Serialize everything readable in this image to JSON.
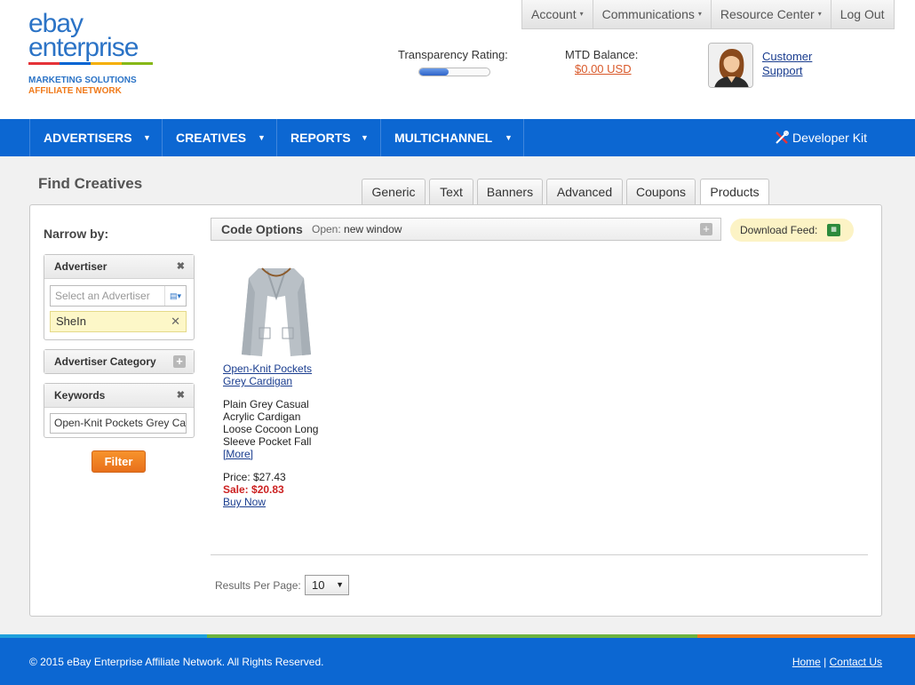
{
  "logo": {
    "line1": "ebay",
    "line2": "enterprise",
    "tag1": "MARKETING SOLUTIONS",
    "tag2": "AFFILIATE NETWORK"
  },
  "top_menu": {
    "account": "Account",
    "communications": "Communications",
    "resource_center": "Resource Center",
    "log_out": "Log Out"
  },
  "stats": {
    "transparency_label": "Transparency Rating:",
    "transparency_level": 0.42,
    "mtd_label": "MTD Balance:",
    "mtd_value": "$0.00 USD"
  },
  "support": {
    "line1": "Customer",
    "line2": "Support"
  },
  "nav": {
    "advertisers": "ADVERTISERS",
    "creatives": "CREATIVES",
    "reports": "REPORTS",
    "multichannel": "MULTICHANNEL",
    "developer_kit": "Developer Kit"
  },
  "page": {
    "title": "Find Creatives"
  },
  "tabs": [
    "Generic",
    "Text",
    "Banners",
    "Advanced",
    "Coupons",
    "Products"
  ],
  "active_tab": "Products",
  "sidebar": {
    "narrow_by": "Narrow by:",
    "advertiser_title": "Advertiser",
    "advertiser_placeholder": "Select an Advertiser",
    "advertiser_selected": "SheIn",
    "category_title": "Advertiser Category",
    "keywords_title": "Keywords",
    "keywords_value": "Open-Knit Pockets Grey Cardigan",
    "filter_label": "Filter"
  },
  "code_options": {
    "title": "Code Options",
    "open_label": "Open:",
    "open_value": "new window"
  },
  "download_feed": "Download Feed:",
  "product": {
    "title_line1": "Open-Knit Pockets",
    "title_line2": "Grey Cardigan",
    "desc": [
      "Plain Grey Casual",
      "Acrylic Cardigan",
      "Loose Cocoon Long",
      "Sleeve Pocket Fall"
    ],
    "more": "[More]",
    "price": "Price: $27.43",
    "sale": "Sale: $20.83",
    "buy_now": "Buy Now"
  },
  "pagination": {
    "results_per_page_label": "Results Per Page:",
    "results_per_page_value": "10"
  },
  "footer": {
    "copyright": "© 2015 eBay Enterprise Affiliate Network. All Rights Reserved.",
    "home": "Home",
    "separator": "|",
    "contact": "Contact Us"
  },
  "colors": {
    "nav_blue": "#0c67d2",
    "accent_orange": "#f07a1a",
    "link_blue": "#1a3d8f"
  }
}
